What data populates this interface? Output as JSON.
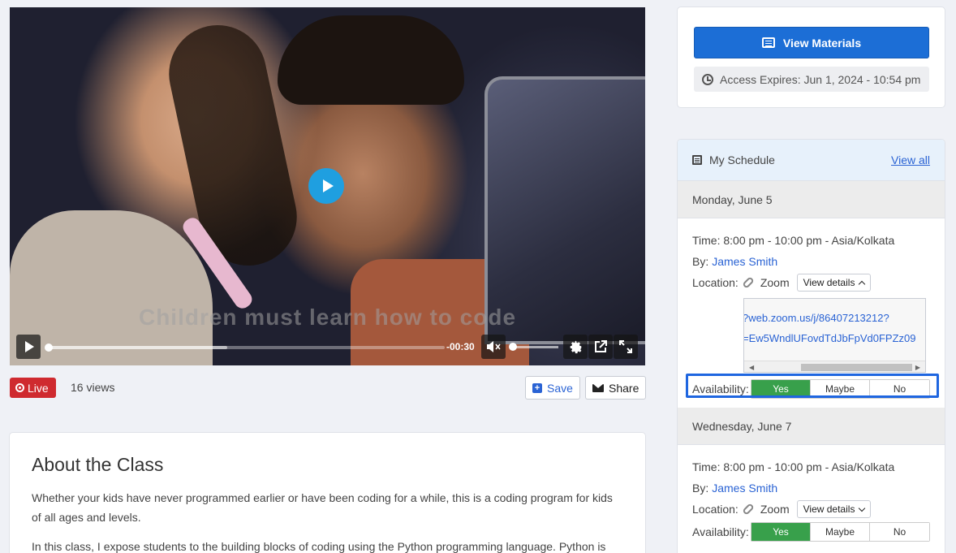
{
  "video": {
    "caption": "Children must learn how to code",
    "time_remaining": "-00:30",
    "progress_fraction": 0.0,
    "volume_fraction": 0.0
  },
  "meta": {
    "live_label": "Live",
    "views": "16 views",
    "save_label": "Save",
    "share_label": "Share"
  },
  "about": {
    "title": "About the Class",
    "para1": "Whether your kids have never programmed earlier or have been coding for a while, this is a coding program for kids of all ages and levels.",
    "para2": "In this class, I expose students to the building blocks of coding using the Python programming language. Python is"
  },
  "materials": {
    "button_label": "View Materials",
    "access_text": "Access Expires: Jun 1, 2024 - 10:54 pm"
  },
  "schedule": {
    "title": "My Schedule",
    "view_all": "View all",
    "days": [
      {
        "date": "Monday, June 5",
        "time": "Time: 8:00 pm - 10:00 pm - Asia/Kolkata",
        "by_label": "By:",
        "instructor": "James Smith",
        "location_label": "Location:",
        "location": "Zoom",
        "details_label": "View details",
        "zoom_line1": "?web.zoom.us/j/86407213212?",
        "zoom_line2": "=Ew5WndlUFovdTdJbFpVd0FPZz09",
        "availability_label": "Availability:",
        "options": [
          "Yes",
          "Maybe",
          "No"
        ],
        "selected": "Yes"
      },
      {
        "date": "Wednesday, June 7",
        "time": "Time: 8:00 pm - 10:00 pm - Asia/Kolkata",
        "by_label": "By:",
        "instructor": "James Smith",
        "location_label": "Location:",
        "location": "Zoom",
        "details_label": "View details",
        "availability_label": "Availability:",
        "options": [
          "Yes",
          "Maybe",
          "No"
        ],
        "selected": "Yes"
      }
    ]
  },
  "colors": {
    "primary": "#1c6ed6",
    "live": "#cf2a2f",
    "yes_selected": "#38a04b",
    "link": "#2a63d4",
    "highlight": "#1f66e0"
  }
}
